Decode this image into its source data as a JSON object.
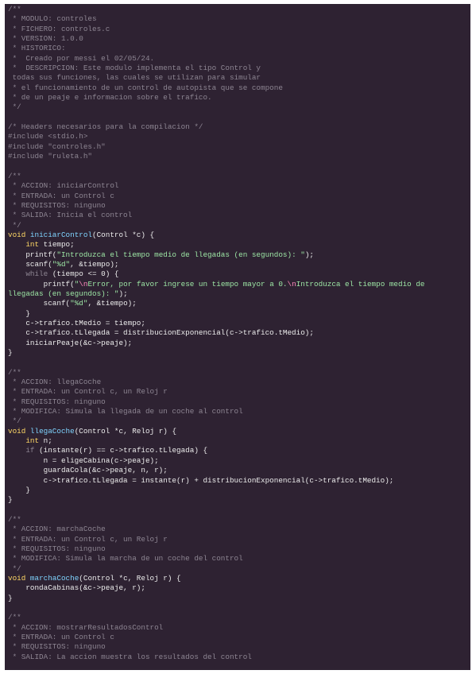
{
  "editor": {
    "colors": {
      "background": "#2e2232",
      "comment": "#8d8592",
      "keyword": "#ffd866",
      "function": "#7fd4ff",
      "string": "#9ce5a4",
      "escape": "#ff8bbd",
      "plain": "#ececec"
    },
    "lines": [
      [
        [
          "comment",
          "/**"
        ]
      ],
      [
        [
          "comment",
          " * MODULO: controles"
        ]
      ],
      [
        [
          "comment",
          " * FICHERO: controles.c"
        ]
      ],
      [
        [
          "comment",
          " * VERSION: 1.0.0"
        ]
      ],
      [
        [
          "comment",
          " * HISTORICO:"
        ]
      ],
      [
        [
          "comment",
          " *  Creado por messi el 02/05/24."
        ]
      ],
      [
        [
          "comment",
          " *  DESCRIPCION: Este modulo implementa el tipo Control y"
        ]
      ],
      [
        [
          "comment",
          " todas sus funciones, las cuales se utilizan para simular"
        ]
      ],
      [
        [
          "comment",
          " * el funcionamiento de un control de autopista que se compone"
        ]
      ],
      [
        [
          "comment",
          " * de un peaje e informacion sobre el trafico."
        ]
      ],
      [
        [
          "comment",
          " */"
        ]
      ],
      [
        [
          "plain",
          ""
        ]
      ],
      [
        [
          "comment",
          "/* Headers necesarios para la compilacion */"
        ]
      ],
      [
        [
          "comment",
          "#include <stdio.h>"
        ]
      ],
      [
        [
          "comment",
          "#include \"controles.h\""
        ]
      ],
      [
        [
          "comment",
          "#include \"ruleta.h\""
        ]
      ],
      [
        [
          "plain",
          ""
        ]
      ],
      [
        [
          "comment",
          "/**"
        ]
      ],
      [
        [
          "comment",
          " * ACCION: iniciarControl"
        ]
      ],
      [
        [
          "comment",
          " * ENTRADA: un Control c"
        ]
      ],
      [
        [
          "comment",
          " * REQUISITOS: ninguno"
        ]
      ],
      [
        [
          "comment",
          " * SALIDA: Inicia el control"
        ]
      ],
      [
        [
          "comment",
          " */"
        ]
      ],
      [
        [
          "keyword",
          "void "
        ],
        [
          "func",
          "iniciarControl"
        ],
        [
          "plain",
          "(Control *c) {"
        ]
      ],
      [
        [
          "plain",
          "    "
        ],
        [
          "keyword",
          "int"
        ],
        [
          "plain",
          " tiempo;"
        ]
      ],
      [
        [
          "plain",
          "    printf("
        ],
        [
          "string",
          "\"Introduzca el tiempo medio de llegadas (en segundos): \""
        ],
        [
          "plain",
          ");"
        ]
      ],
      [
        [
          "plain",
          "    scanf("
        ],
        [
          "string",
          "\"%d\""
        ],
        [
          "plain",
          ", &tiempo);"
        ]
      ],
      [
        [
          "plain",
          "    "
        ],
        [
          "comment",
          "while"
        ],
        [
          "plain",
          " (tiempo <= 0) {"
        ]
      ],
      [
        [
          "plain",
          "        printf("
        ],
        [
          "string",
          "\""
        ],
        [
          "escape",
          "\\n"
        ],
        [
          "string",
          "Error, por favor ingrese un tiempo mayor a 0."
        ],
        [
          "escape",
          "\\n"
        ],
        [
          "string",
          "Introduzca el tiempo medio de"
        ]
      ],
      [
        [
          "string",
          "llegadas (en segundos): \""
        ],
        [
          "plain",
          ");"
        ]
      ],
      [
        [
          "plain",
          "        scanf("
        ],
        [
          "string",
          "\"%d\""
        ],
        [
          "plain",
          ", &tiempo);"
        ]
      ],
      [
        [
          "plain",
          "    }"
        ]
      ],
      [
        [
          "plain",
          "    c->trafico.tMedio = tiempo;"
        ]
      ],
      [
        [
          "plain",
          "    c->trafico.tLlegada = distribucionExponencial(c->trafico.tMedio);"
        ]
      ],
      [
        [
          "plain",
          "    iniciarPeaje(&c->peaje);"
        ]
      ],
      [
        [
          "plain",
          "}"
        ]
      ],
      [
        [
          "plain",
          ""
        ]
      ],
      [
        [
          "comment",
          "/**"
        ]
      ],
      [
        [
          "comment",
          " * ACCION: llegaCoche"
        ]
      ],
      [
        [
          "comment",
          " * ENTRADA: un Control c, un Reloj r"
        ]
      ],
      [
        [
          "comment",
          " * REQUISITOS: ninguno"
        ]
      ],
      [
        [
          "comment",
          " * MODIFICA: Simula la llegada de un coche al control"
        ]
      ],
      [
        [
          "comment",
          " */"
        ]
      ],
      [
        [
          "keyword",
          "void "
        ],
        [
          "func",
          "llegaCoche"
        ],
        [
          "plain",
          "(Control *c, Reloj r) {"
        ]
      ],
      [
        [
          "plain",
          "    "
        ],
        [
          "keyword",
          "int"
        ],
        [
          "plain",
          " n;"
        ]
      ],
      [
        [
          "plain",
          "    "
        ],
        [
          "comment",
          "if"
        ],
        [
          "plain",
          " (instante(r) == c->trafico.tLlegada) {"
        ]
      ],
      [
        [
          "plain",
          "        n = eligeCabina(c->peaje);"
        ]
      ],
      [
        [
          "plain",
          "        guardaCola(&c->peaje, n, r);"
        ]
      ],
      [
        [
          "plain",
          "        c->trafico.tLlegada = instante(r) + distribucionExponencial(c->trafico.tMedio);"
        ]
      ],
      [
        [
          "plain",
          "    }"
        ]
      ],
      [
        [
          "plain",
          "}"
        ]
      ],
      [
        [
          "plain",
          ""
        ]
      ],
      [
        [
          "comment",
          "/**"
        ]
      ],
      [
        [
          "comment",
          " * ACCION: marchaCoche"
        ]
      ],
      [
        [
          "comment",
          " * ENTRADA: un Control c, un Reloj r"
        ]
      ],
      [
        [
          "comment",
          " * REQUISITOS: ninguno"
        ]
      ],
      [
        [
          "comment",
          " * MODIFICA: Simula la marcha de un coche del control"
        ]
      ],
      [
        [
          "comment",
          " */"
        ]
      ],
      [
        [
          "keyword",
          "void "
        ],
        [
          "func",
          "marchaCoche"
        ],
        [
          "plain",
          "(Control *c, Reloj r) {"
        ]
      ],
      [
        [
          "plain",
          "    rondaCabinas(&c->peaje, r);"
        ]
      ],
      [
        [
          "plain",
          "}"
        ]
      ],
      [
        [
          "plain",
          ""
        ]
      ],
      [
        [
          "comment",
          "/**"
        ]
      ],
      [
        [
          "comment",
          " * ACCION: mostrarResultadosControl"
        ]
      ],
      [
        [
          "comment",
          " * ENTRADA: un Control c"
        ]
      ],
      [
        [
          "comment",
          " * REQUISITOS: ninguno"
        ]
      ],
      [
        [
          "comment",
          " * SALIDA: La accion muestra los resultados del control"
        ]
      ]
    ]
  }
}
